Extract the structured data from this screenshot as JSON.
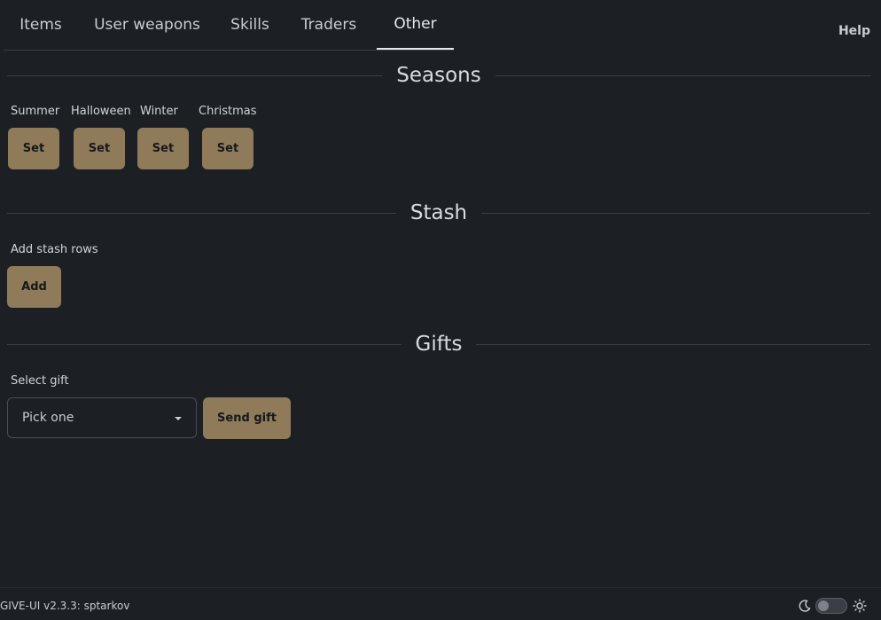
{
  "tabs": [
    {
      "label": "Items"
    },
    {
      "label": "User weapons"
    },
    {
      "label": "Skills"
    },
    {
      "label": "Traders"
    },
    {
      "label": "Other"
    }
  ],
  "active_tab": "Other",
  "help_label": "Help",
  "seasons": {
    "title": "Seasons",
    "items": [
      {
        "label": "Summer",
        "button": "Set"
      },
      {
        "label": "Halloween",
        "button": "Set"
      },
      {
        "label": "Winter",
        "button": "Set"
      },
      {
        "label": "Christmas",
        "button": "Set"
      }
    ]
  },
  "stash": {
    "title": "Stash",
    "label": "Add stash rows",
    "button": "Add"
  },
  "gifts": {
    "title": "Gifts",
    "label": "Select gift",
    "select_value": "Pick one",
    "button": "Send gift"
  },
  "footer": {
    "version": "GIVE-UI v2.3.3: sptarkov",
    "theme_dark_mode": false
  },
  "colors": {
    "background": "#1c1f24",
    "button": "#8f7b5a",
    "text": "#d8dadd"
  }
}
